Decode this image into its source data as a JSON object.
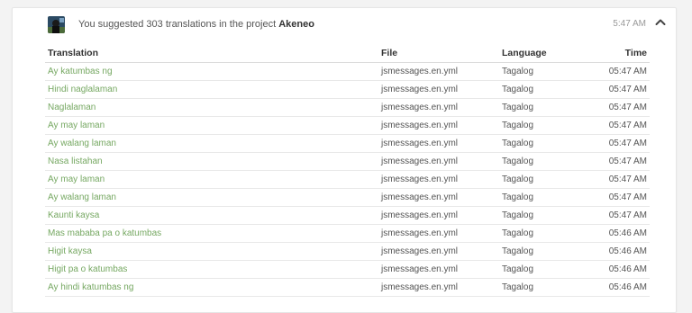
{
  "activity": {
    "summary_prefix": "You suggested 303 translations in the project",
    "project_name": "Akeneo",
    "timestamp": "5:47 AM",
    "icon": "translate-icon",
    "collapse_icon": "chevron-up-icon"
  },
  "table": {
    "headers": {
      "translation": "Translation",
      "file": "File",
      "language": "Language",
      "time": "Time"
    },
    "rows": [
      {
        "translation": "Ay katumbas ng",
        "file": "jsmessages.en.yml",
        "language": "Tagalog",
        "time": "05:47 AM"
      },
      {
        "translation": "Hindi naglalaman",
        "file": "jsmessages.en.yml",
        "language": "Tagalog",
        "time": "05:47 AM"
      },
      {
        "translation": "Naglalaman",
        "file": "jsmessages.en.yml",
        "language": "Tagalog",
        "time": "05:47 AM"
      },
      {
        "translation": "Ay may laman",
        "file": "jsmessages.en.yml",
        "language": "Tagalog",
        "time": "05:47 AM"
      },
      {
        "translation": "Ay walang laman",
        "file": "jsmessages.en.yml",
        "language": "Tagalog",
        "time": "05:47 AM"
      },
      {
        "translation": "Nasa listahan",
        "file": "jsmessages.en.yml",
        "language": "Tagalog",
        "time": "05:47 AM"
      },
      {
        "translation": "Ay may laman",
        "file": "jsmessages.en.yml",
        "language": "Tagalog",
        "time": "05:47 AM"
      },
      {
        "translation": "Ay walang laman",
        "file": "jsmessages.en.yml",
        "language": "Tagalog",
        "time": "05:47 AM"
      },
      {
        "translation": "Kaunti kaysa",
        "file": "jsmessages.en.yml",
        "language": "Tagalog",
        "time": "05:47 AM"
      },
      {
        "translation": "Mas mababa pa o katumbas",
        "file": "jsmessages.en.yml",
        "language": "Tagalog",
        "time": "05:46 AM"
      },
      {
        "translation": "Higit kaysa",
        "file": "jsmessages.en.yml",
        "language": "Tagalog",
        "time": "05:46 AM"
      },
      {
        "translation": "Higit pa o katumbas",
        "file": "jsmessages.en.yml",
        "language": "Tagalog",
        "time": "05:46 AM"
      },
      {
        "translation": "Ay hindi katumbas ng",
        "file": "jsmessages.en.yml",
        "language": "Tagalog",
        "time": "05:46 AM"
      }
    ]
  },
  "colors": {
    "link": "#76a862",
    "background": "#f3f3f3"
  }
}
